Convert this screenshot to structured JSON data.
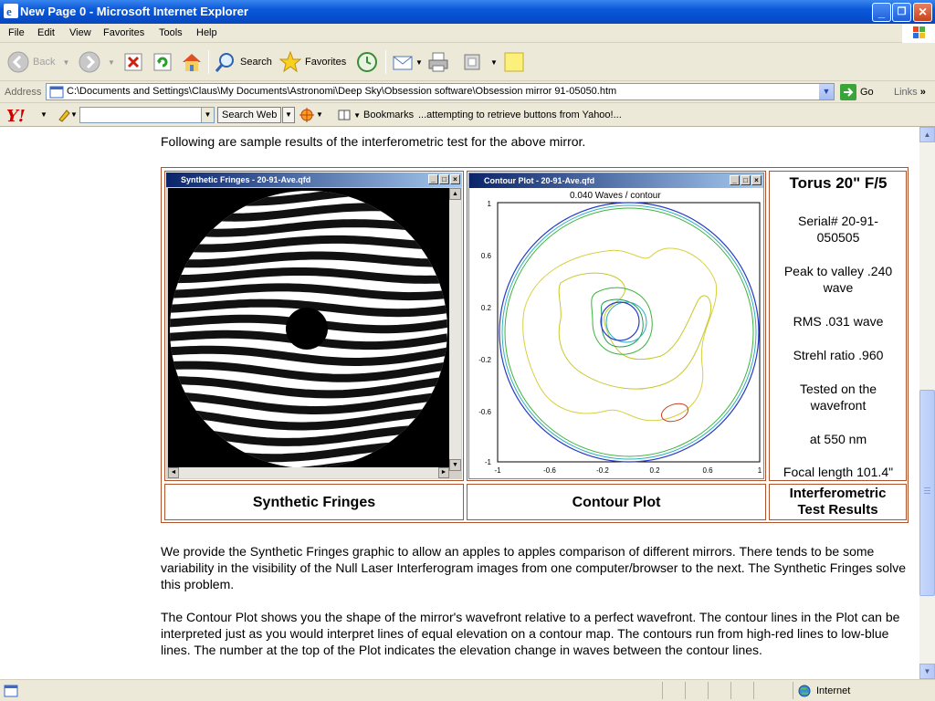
{
  "window": {
    "title": "New Page 0 - Microsoft Internet Explorer",
    "minimize": "_",
    "restore": "❐",
    "close": "×"
  },
  "menu": [
    "File",
    "Edit",
    "View",
    "Favorites",
    "Tools",
    "Help"
  ],
  "toolbar": {
    "back": "Back",
    "search": "Search",
    "favorites": "Favorites"
  },
  "address": {
    "label": "Address",
    "url": "C:\\Documents and Settings\\Claus\\My Documents\\Astronomi\\Deep Sky\\Obsession software\\Obsession mirror 91-05050.htm",
    "go": "Go",
    "links": "Links"
  },
  "yahoo": {
    "logo": "Y!",
    "search_value": "",
    "search_button": "Search Web",
    "bookmarks": "Bookmarks",
    "message": "...attempting to retrieve buttons from Yahoo!..."
  },
  "page": {
    "intro": "Following are sample results of the interferometric test for the above mirror.",
    "fringes_window_title": "Synthetic Fringes - 20-91-Ave.qfd",
    "contour_window_title": "Contour Plot - 20-91-Ave.qfd",
    "contour_subtitle": "0.040 Waves / contour",
    "y_ticks": [
      "1",
      "0.6",
      "0.2",
      "-0.2",
      "-0.6",
      "-1"
    ],
    "x_ticks": [
      "-1",
      "-0.6",
      "-0.2",
      "0.2",
      "0.6",
      "1"
    ],
    "results": {
      "title": "Torus 20\" F/5",
      "serial": "Serial# 20-91-050505",
      "ptv": "Peak to valley .240 wave",
      "rms": "RMS .031 wave",
      "strehl": "Strehl ratio .960",
      "tested": "Tested on the wavefront",
      "wavelength": "at 550 nm",
      "focal": "Focal length 101.4\""
    },
    "captions": {
      "fringes": "Synthetic Fringes",
      "contour": "Contour Plot",
      "results": "Interferometric Test Results"
    },
    "para1": "We provide the Synthetic Fringes graphic to allow an apples to apples comparison of different mirrors. There tends to be some variability in the visibility of the Null Laser Interferogram images from one computer/browser to the next. The Synthetic Fringes solve this problem.",
    "para2": "The Contour Plot shows you the shape of the mirror's wavefront relative to a perfect wavefront. The contour lines in the Plot can be interpreted just as you would interpret lines of equal elevation on a contour map. The contours run from high-red lines to low-blue lines. The number at the top of the Plot indicates the elevation change in waves between the contour lines."
  },
  "status": {
    "zone": "Internet"
  },
  "colors": {
    "table_border": "#b0522c",
    "contour_outer": "#2a3cc8",
    "contour_yellow": "#d8d040",
    "contour_green": "#3cb43c",
    "contour_red": "#c84020"
  }
}
